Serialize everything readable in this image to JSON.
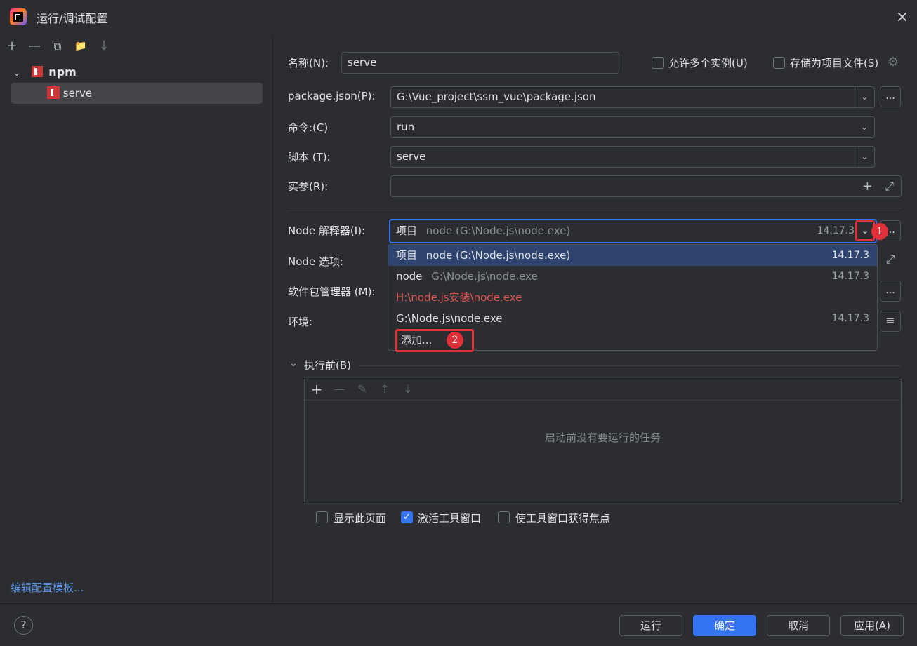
{
  "window": {
    "title": "运行/调试配置",
    "close_icon": "×"
  },
  "left": {
    "toolbar_icons": [
      "+",
      "—",
      "⧉",
      "📁",
      "↓"
    ],
    "tree": {
      "group_chevron": "⌄",
      "group_label": "npm",
      "selected_item": "serve"
    },
    "edit_templates_link": "编辑配置模板..."
  },
  "form": {
    "name_label": "名称(N):",
    "name_value": "serve",
    "allow_multiple_label": "允许多个实例(U)",
    "store_as_file_label": "存储为项目文件(S)",
    "package_json_label": "package.json(P):",
    "package_json_value": "G:\\Vue_project\\ssm_vue\\package.json",
    "command_label": "命令:(C)",
    "command_value": "run",
    "scripts_label": "脚本 (T):",
    "scripts_value": "serve",
    "args_label": "实参(R):",
    "args_value": "",
    "node_interpreter_label": "Node 解释器(I):",
    "node_interpreter_prefix": "项目",
    "node_interpreter_value": "node (G:\\Node.js\\node.exe)",
    "node_interpreter_version": "14.17.3",
    "node_options_label": "Node 选项:",
    "package_manager_label": "软件包管理器 (M):",
    "env_label": "环境:",
    "dots": "...",
    "plus_icon": "+",
    "expand_icon": "⤢",
    "chevron": "⌄",
    "gear_icon": "⚙",
    "doc_icon": "≡"
  },
  "dropdown": {
    "items": [
      {
        "prefix": "项目",
        "text": "node (G:\\Node.js\\node.exe)",
        "version": "14.17.3"
      },
      {
        "prefix": "node",
        "text": "G:\\Node.js\\node.exe",
        "version": "14.17.3"
      },
      {
        "prefix": "",
        "text": "H:\\node.js安装\\node.exe",
        "version": ""
      },
      {
        "prefix": "",
        "text": "G:\\Node.js\\node.exe",
        "version": "14.17.3"
      },
      {
        "prefix": "",
        "text": "添加...",
        "version": ""
      }
    ]
  },
  "annotations": {
    "one": "1",
    "two": "2",
    "color": "#e0303a"
  },
  "before_launch": {
    "chevron": "⌄",
    "title": "执行前(B)",
    "toolbar_icons": [
      "+",
      "—",
      "✎",
      "⇡",
      "⇣"
    ],
    "empty_text": "启动前没有要运行的任务"
  },
  "options": {
    "show_page_label": "显示此页面",
    "activate_tool_window_label": "激活工具窗口",
    "activate_tool_window_checked": "✓",
    "focus_tool_window_label": "使工具窗口获得焦点"
  },
  "footer": {
    "help": "?",
    "run": "运行",
    "ok": "确定",
    "cancel": "取消",
    "apply": "应用(A)"
  },
  "colors": {
    "accent": "#3574f0",
    "background": "#2b2d30",
    "selection": "#2e436e",
    "error_text": "#e05555"
  }
}
